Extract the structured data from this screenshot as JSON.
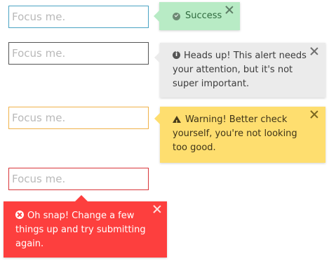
{
  "fields": [
    {
      "placeholder": "Focus me."
    },
    {
      "placeholder": "Focus me."
    },
    {
      "placeholder": "Focus me."
    },
    {
      "placeholder": "Focus me."
    }
  ],
  "alerts": [
    {
      "type": "success",
      "icon": "check-circle-icon",
      "message": "Success",
      "background": "#b8ebc5"
    },
    {
      "type": "info",
      "icon": "info-circle-icon",
      "message": "Heads up! This alert needs your attention, but it's not super important.",
      "background": "#ebebeb"
    },
    {
      "type": "warning",
      "icon": "warning-triangle-icon",
      "message": "Warning! Better check yourself, you're not looking too good.",
      "background": "#fede6f"
    },
    {
      "type": "error",
      "icon": "error-circle-icon",
      "message": "Oh snap! Change a few things up and try submitting again.",
      "background": "#fd3f3e"
    }
  ]
}
